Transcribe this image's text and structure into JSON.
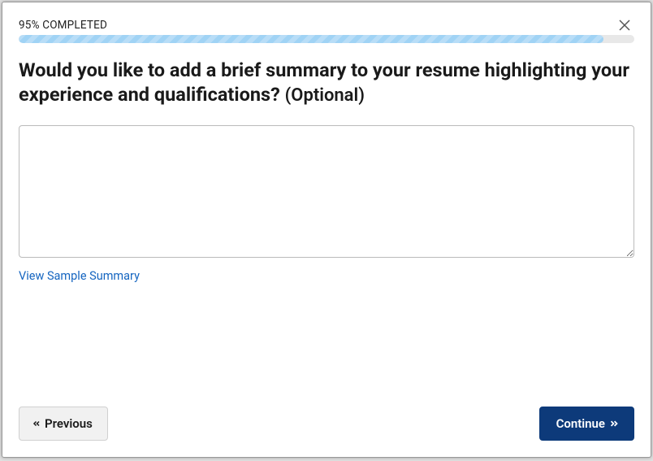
{
  "progress": {
    "label": "95% COMPLETED",
    "percent": 95
  },
  "heading": {
    "main": "Would you like to add a brief summary to your resume highlighting your experience and qualifications?",
    "optional": "(Optional)"
  },
  "textarea": {
    "value": ""
  },
  "link": {
    "sample": "View Sample Summary"
  },
  "buttons": {
    "previous": "Previous",
    "continue": "Continue"
  }
}
